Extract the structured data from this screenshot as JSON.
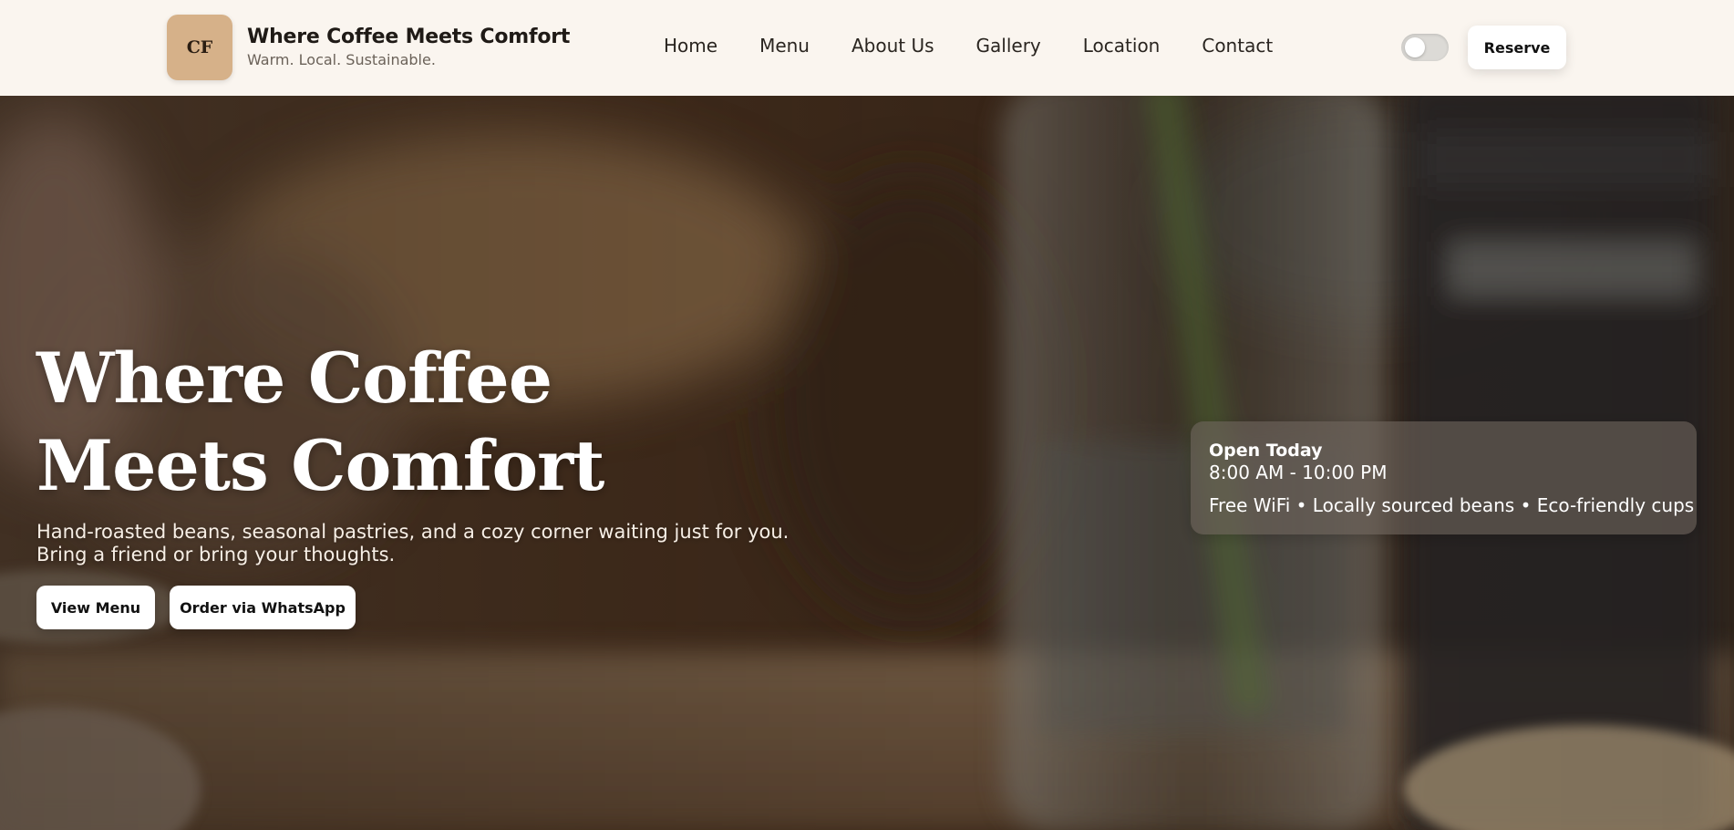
{
  "header": {
    "logo_text": "CF",
    "brand_title": "Where Coffee Meets Comfort",
    "brand_subtitle": "Warm. Local. Sustainable.",
    "nav": [
      "Home",
      "Menu",
      "About Us",
      "Gallery",
      "Location",
      "Contact"
    ],
    "theme_toggle": {
      "icon": "toggle-switch",
      "state": "off"
    },
    "reserve_label": "Reserve"
  },
  "hero": {
    "title": "Where Coffee Meets Comfort",
    "description": "Hand-roasted beans, seasonal pastries, and a cozy corner waiting just for you. Bring a friend or bring your thoughts.",
    "buttons": {
      "view_menu": "View Menu",
      "whatsapp": "Order via WhatsApp"
    }
  },
  "info_card": {
    "status": "Open Today",
    "hours": "8:00 AM - 10:00 PM",
    "features": "Free WiFi • Locally sourced beans • Eco-friendly cups"
  },
  "colors": {
    "header_bg": "#faf5ef",
    "logo_bg": "#d6b189",
    "text_dark": "#1f1a16",
    "button_bg": "#ffffff"
  }
}
